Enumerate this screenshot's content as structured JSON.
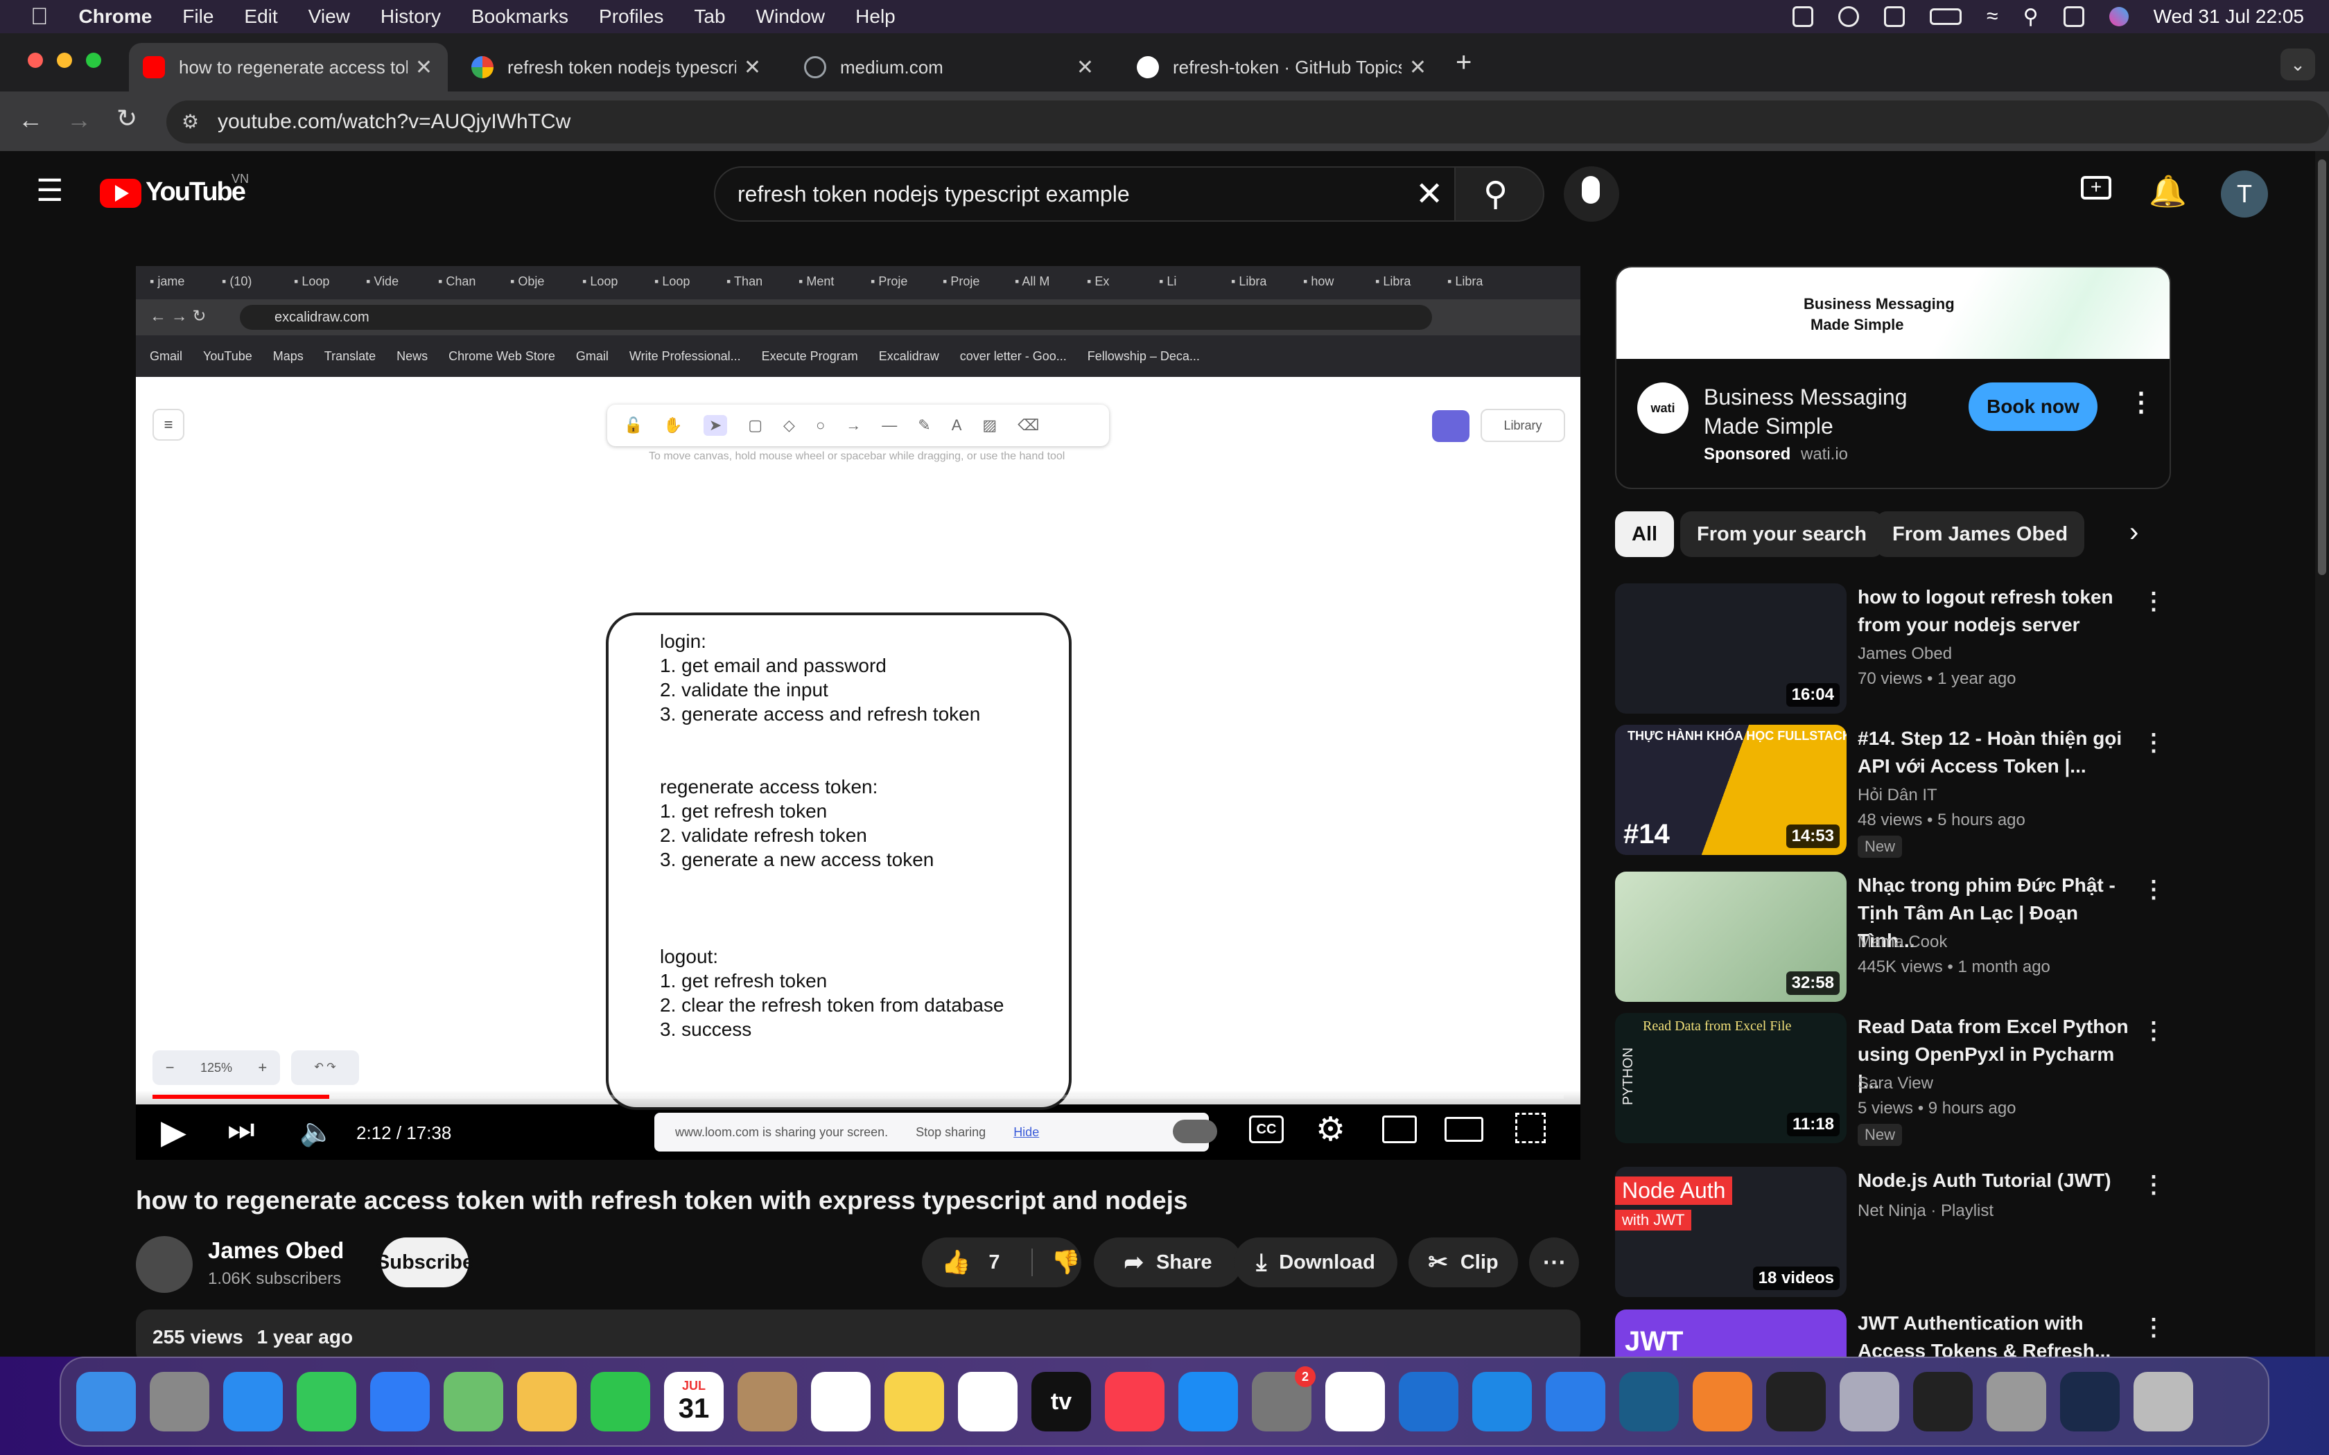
{
  "menubar": {
    "apple": "",
    "app": "Chrome",
    "items": [
      "File",
      "Edit",
      "View",
      "History",
      "Bookmarks",
      "Profiles",
      "Tab",
      "Window",
      "Help"
    ],
    "clock": "Wed 31 Jul  22:05"
  },
  "tabs": [
    {
      "title": "how to regenerate access tok",
      "icon": "youtube-icon",
      "color": "#ff0000"
    },
    {
      "title": "refresh token nodejs typescri",
      "icon": "google-icon",
      "color": "#4285f4"
    },
    {
      "title": "medium.com",
      "icon": "globe-icon",
      "color": "#9aa0a6"
    },
    {
      "title": "refresh-token · GitHub Topics",
      "icon": "github-icon",
      "color": "#ffffff"
    }
  ],
  "address": "youtube.com/watch?v=AUQjyIWhTCw",
  "youtube": {
    "logo": "YouTube",
    "region": "VN",
    "search_value": "refresh token nodejs typescript example",
    "avatar": "T"
  },
  "video_inner": {
    "url": "excalidraw.com",
    "bookmarks": [
      "Gmail",
      "YouTube",
      "Maps",
      "Translate",
      "News",
      "Chrome Web Store",
      "Gmail",
      "Write Professional...",
      "Execute Program",
      "Excalidraw",
      "cover letter - Goo...",
      "Fellowship – Deca..."
    ],
    "inner_tabs": [
      "jame",
      "(10)",
      "Loop",
      "Vide",
      "Chan",
      "Obje",
      "Loop",
      "Loop",
      "Than",
      "Ment",
      "Proje",
      "Proje",
      "All M",
      "Ex",
      "Li",
      "Libra",
      "how",
      "Libra",
      "Libra"
    ],
    "hint": "To move canvas, hold mouse wheel or spacebar while dragging, or use the hand tool",
    "library": "Library",
    "zoom": "125%",
    "note_lines": "login:\n1. get email and password\n2. validate the input\n3. generate access and refresh token\n\n\nregenerate access token:\n1. get refresh token\n2. validate refresh token\n3. generate a new access token\n\n\n\nlogout:\n1. get refresh token\n2. clear the refresh token from database\n3. success",
    "loom_msg": "www.loom.com is sharing your screen.",
    "stop_sharing": "Stop sharing",
    "hide": "Hide"
  },
  "player": {
    "time": "2:12 / 17:38",
    "progress_fraction": 0.125,
    "cc": "CC"
  },
  "video": {
    "title": "how to regenerate access token with refresh token with express typescript and nodejs",
    "channel": "James Obed",
    "subscribers": "1.06K subscribers",
    "subscribe": "Subscribe",
    "likes": "7",
    "share": "Share",
    "download": "Download",
    "clip": "Clip",
    "views": "255 views",
    "age": "1 year ago"
  },
  "ad": {
    "banner_line1": "Business Messaging",
    "banner_line2": "Made Simple",
    "title": "Business Messaging Made Simple",
    "sponsored": "Sponsored",
    "domain": "wati.io",
    "cta": "Book now",
    "logo_text": "wati"
  },
  "chips": [
    "All",
    "From your search",
    "From James Obed"
  ],
  "recommendations": [
    {
      "title": "how to logout refresh token from your nodejs server",
      "channel": "James Obed",
      "meta": "70 views  •  1 year ago",
      "duration": "16:04",
      "new": ""
    },
    {
      "title": "#14. Step 12 - Hoàn thiện gọi API với Access Token |...",
      "channel": "Hỏi Dân IT",
      "meta": "48 views  •  5 hours ago",
      "duration": "14:53",
      "new": "New",
      "thumb_text": "THỰC HÀNH KHÓA HỌC FULLSTACK",
      "thumb_num": "#14"
    },
    {
      "title": "Nhạc trong phim Đức Phật - Tịnh Tâm An Lạc | Đoạn Tình...",
      "channel": "Mama Cook",
      "meta": "445K views  •  1 month ago",
      "duration": "32:58",
      "new": ""
    },
    {
      "title": "Read Data from Excel Python using OpenPyxl in Pycharm |...",
      "channel": "Sara View",
      "meta": "5 views  •  9 hours ago",
      "duration": "11:18",
      "new": "New",
      "thumb_text": "Read Data from Excel File",
      "thumb_side": "PYTHON"
    },
    {
      "title": "Node.js Auth Tutorial (JWT)",
      "channel": "Net Ninja · Playlist",
      "meta": "",
      "duration": "18 videos",
      "new": "",
      "thumb_text": "Node Auth",
      "thumb_sub": "with JWT"
    },
    {
      "title": "JWT Authentication with Access Tokens & Refresh...",
      "channel": "",
      "meta": "",
      "duration": "",
      "new": "",
      "thumb_text": "JWT"
    }
  ],
  "dock": {
    "calendar_month": "JUL",
    "calendar_day": "31",
    "settings_badge": "2",
    "apps": [
      "finder",
      "launchpad",
      "safari",
      "messages",
      "mail",
      "maps",
      "photos",
      "facetime",
      "calendar",
      "contacts",
      "reminders",
      "notes",
      "freeform",
      "tv",
      "music",
      "app-store",
      "system-settings",
      "chrome",
      "vscode",
      "xcode",
      "simulator",
      "mysql",
      "pages",
      "terminal",
      "preview",
      "activity-monitor",
      "disk-utility",
      "html-file",
      "trash"
    ],
    "tv_label": "tv"
  }
}
